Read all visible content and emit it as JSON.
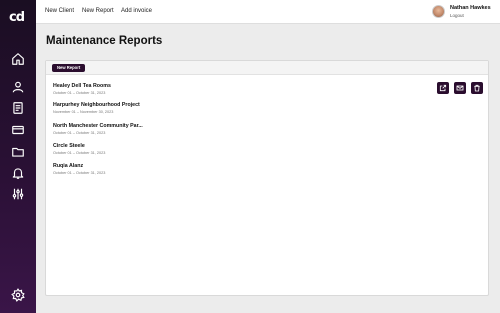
{
  "sidebar": {
    "logo_text": "cd",
    "icons": [
      "home-icon",
      "user-icon",
      "document-icon",
      "credit-card-icon",
      "folder-icon",
      "bell-icon",
      "sliders-icon",
      "settings-icon"
    ]
  },
  "topbar": {
    "links": [
      "New Client",
      "New Report",
      "Add invoice"
    ],
    "user_name": "Nathan Hawkes",
    "logout_label": "Logout"
  },
  "page": {
    "title": "Maintenance Reports"
  },
  "toolbar": {
    "new_report_label": "New Report"
  },
  "reports": [
    {
      "title": "Healey Dell Tea Rooms",
      "dates": "October 01 – October 31, 2023"
    },
    {
      "title": "Harpurhey Neighbourhood Project",
      "dates": "November 01 – November 30, 2023"
    },
    {
      "title": "North Manchester Community Par...",
      "dates": "October 01 – October 31, 2023"
    },
    {
      "title": "Circle Steele",
      "dates": "October 01 – October 31, 2023"
    },
    {
      "title": "Ruqia Alanz",
      "dates": "October 01 – October 31, 2023"
    }
  ],
  "row_actions": [
    "share-icon",
    "mail-icon",
    "trash-icon"
  ],
  "colors": {
    "sidebar": "#1a0e22",
    "accent": "#2a0d2e",
    "background": "#ececec"
  }
}
